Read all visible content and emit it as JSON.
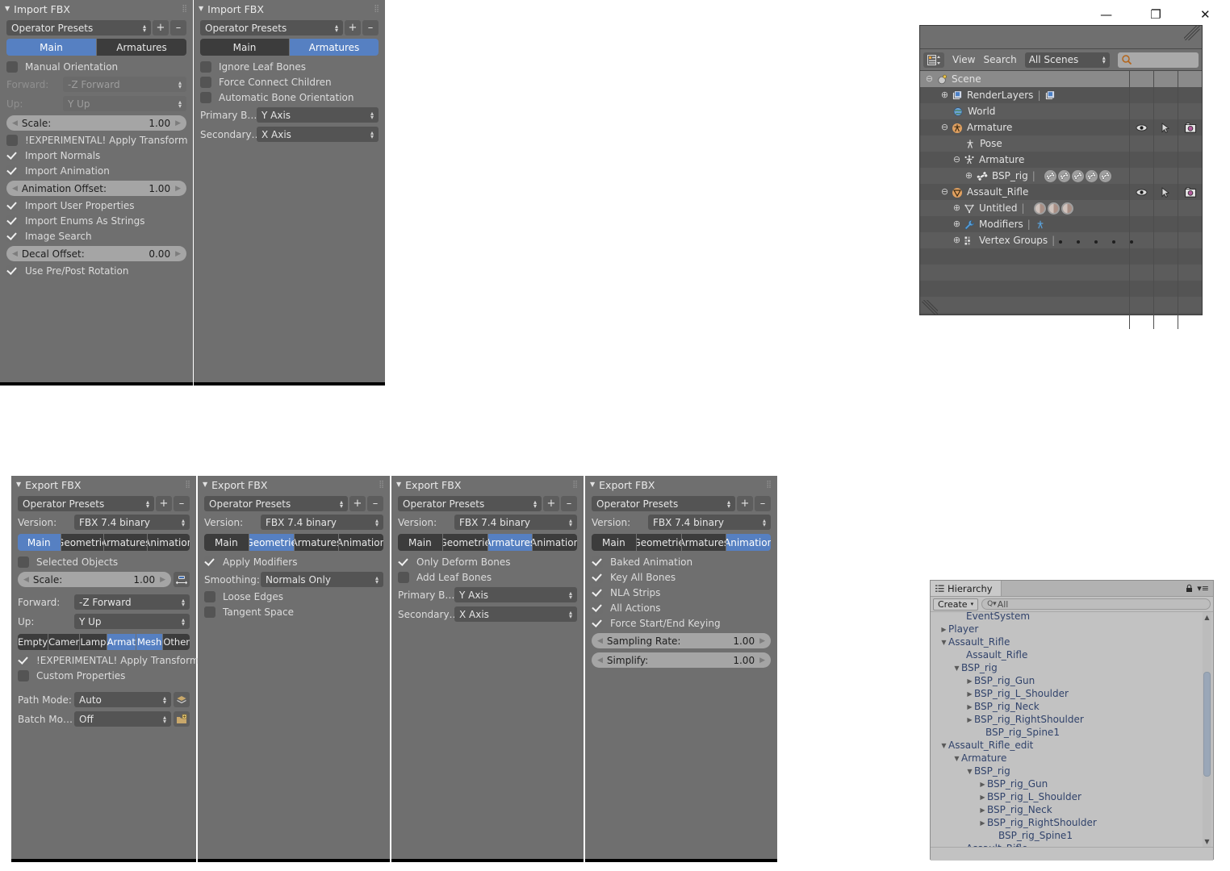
{
  "window": {
    "minimize": "—",
    "maximize": "❐",
    "close": "✕"
  },
  "import_main": {
    "title": "Import FBX",
    "preset": "Operator Presets",
    "add_btn": "+",
    "remove_btn": "–",
    "tabs": [
      {
        "label": "Main",
        "active": true
      },
      {
        "label": "Armatures",
        "active": false
      }
    ],
    "manual_orientation": {
      "label": "Manual Orientation",
      "checked": false
    },
    "forward": {
      "label": "Forward:",
      "value": "-Z Forward",
      "enabled": false
    },
    "up": {
      "label": "Up:",
      "value": "Y Up",
      "enabled": false
    },
    "scale": {
      "label": "Scale:",
      "value": "1.00"
    },
    "apply_transform": {
      "label": "!EXPERIMENTAL! Apply Transform",
      "checked": false
    },
    "import_normals": {
      "label": "Import Normals",
      "checked": true
    },
    "import_animation": {
      "label": "Import Animation",
      "checked": true
    },
    "animation_offset": {
      "label": "Animation Offset:",
      "value": "1.00"
    },
    "import_user_properties": {
      "label": "Import User Properties",
      "checked": true
    },
    "import_enums": {
      "label": "Import Enums As Strings",
      "checked": true
    },
    "image_search": {
      "label": "Image Search",
      "checked": true
    },
    "decal_offset": {
      "label": "Decal Offset:",
      "value": "0.00"
    },
    "use_prepost_rotation": {
      "label": "Use Pre/Post Rotation",
      "checked": true
    }
  },
  "import_armatures": {
    "title": "Import FBX",
    "preset": "Operator Presets",
    "add_btn": "+",
    "remove_btn": "–",
    "tabs": [
      {
        "label": "Main",
        "active": false
      },
      {
        "label": "Armatures",
        "active": true
      }
    ],
    "ignore_leaf_bones": {
      "label": "Ignore Leaf Bones",
      "checked": false
    },
    "force_connect_children": {
      "label": "Force Connect Children",
      "checked": false
    },
    "automatic_bone_orientation": {
      "label": "Automatic Bone Orientation",
      "checked": false
    },
    "primary_bone_axis": {
      "label": "Primary B…",
      "value": "Y Axis"
    },
    "secondary_bone_axis": {
      "label": "Secondary…",
      "value": "X Axis"
    }
  },
  "export_main": {
    "title": "Export FBX",
    "preset": "Operator Presets",
    "add_btn": "+",
    "remove_btn": "–",
    "version": {
      "label": "Version:",
      "value": "FBX 7.4 binary"
    },
    "tabs": [
      {
        "label": "Main",
        "active": true
      },
      {
        "label": "Geometrie",
        "active": false
      },
      {
        "label": "Armatures",
        "active": false
      },
      {
        "label": "Animation",
        "active": false
      }
    ],
    "selected_objects": {
      "label": "Selected Objects",
      "checked": false
    },
    "scale": {
      "label": "Scale:",
      "value": "1.00"
    },
    "forward": {
      "label": "Forward:",
      "value": "-Z Forward"
    },
    "up": {
      "label": "Up:",
      "value": "Y Up"
    },
    "object_types": [
      {
        "label": "Empty",
        "active": false
      },
      {
        "label": "Camer",
        "active": false
      },
      {
        "label": "Lamp",
        "active": false
      },
      {
        "label": "Armat",
        "active": true
      },
      {
        "label": "Mesh",
        "active": true
      },
      {
        "label": "Other",
        "active": false
      }
    ],
    "apply_transform": {
      "label": "!EXPERIMENTAL! Apply Transform",
      "checked": true
    },
    "custom_properties": {
      "label": "Custom Properties",
      "checked": false
    },
    "path_mode": {
      "label": "Path Mode:",
      "value": "Auto"
    },
    "batch_mode": {
      "label": "Batch Mo…",
      "value": "Off"
    }
  },
  "export_geometries": {
    "title": "Export FBX",
    "preset": "Operator Presets",
    "add_btn": "+",
    "remove_btn": "–",
    "version": {
      "label": "Version:",
      "value": "FBX 7.4 binary"
    },
    "tabs": [
      {
        "label": "Main",
        "active": false
      },
      {
        "label": "Geometrie",
        "active": true
      },
      {
        "label": "Armatures",
        "active": false
      },
      {
        "label": "Animation",
        "active": false
      }
    ],
    "apply_modifiers": {
      "label": "Apply Modifiers",
      "checked": true
    },
    "smoothing": {
      "label": "Smoothing:",
      "value": "Normals Only"
    },
    "loose_edges": {
      "label": "Loose Edges",
      "checked": false
    },
    "tangent_space": {
      "label": "Tangent Space",
      "checked": false
    }
  },
  "export_armatures": {
    "title": "Export FBX",
    "preset": "Operator Presets",
    "add_btn": "+",
    "remove_btn": "–",
    "version": {
      "label": "Version:",
      "value": "FBX 7.4 binary"
    },
    "tabs": [
      {
        "label": "Main",
        "active": false
      },
      {
        "label": "Geometrie",
        "active": false
      },
      {
        "label": "Armatures",
        "active": true
      },
      {
        "label": "Animation",
        "active": false
      }
    ],
    "only_deform_bones": {
      "label": "Only Deform Bones",
      "checked": true
    },
    "add_leaf_bones": {
      "label": "Add Leaf Bones",
      "checked": false
    },
    "primary_bone_axis": {
      "label": "Primary B…",
      "value": "Y Axis"
    },
    "secondary_bone_axis": {
      "label": "Secondary…",
      "value": "X Axis"
    }
  },
  "export_animation": {
    "title": "Export FBX",
    "preset": "Operator Presets",
    "add_btn": "+",
    "remove_btn": "–",
    "version": {
      "label": "Version:",
      "value": "FBX 7.4 binary"
    },
    "tabs": [
      {
        "label": "Main",
        "active": false
      },
      {
        "label": "Geometrie",
        "active": false
      },
      {
        "label": "Armatures",
        "active": false
      },
      {
        "label": "Animation",
        "active": true
      }
    ],
    "baked_animation": {
      "label": "Baked Animation",
      "checked": true
    },
    "key_all_bones": {
      "label": "Key All Bones",
      "checked": true
    },
    "nla_strips": {
      "label": "NLA Strips",
      "checked": true
    },
    "all_actions": {
      "label": "All Actions",
      "checked": true
    },
    "force_start_end_keying": {
      "label": "Force Start/End Keying",
      "checked": true
    },
    "sampling_rate": {
      "label": "Sampling Rate:",
      "value": "1.00"
    },
    "simplify": {
      "label": "Simplify:",
      "value": "1.00"
    }
  },
  "outliner": {
    "menu_view": "View",
    "menu_search": "Search",
    "scene_filter": "All Scenes",
    "search_value": "",
    "rows": [
      {
        "name": "Scene",
        "indent": 0,
        "toggle": "minus",
        "icon": "scene-icon",
        "selected": true
      },
      {
        "name": "RenderLayers",
        "indent": 1,
        "toggle": "plus",
        "icon": "renderlayers-icon",
        "extra": "renderlayer-chip"
      },
      {
        "name": "World",
        "indent": 1,
        "toggle": "none",
        "icon": "world-icon"
      },
      {
        "name": "Armature",
        "indent": 1,
        "toggle": "minus",
        "icon": "armature-object-icon",
        "cols": true
      },
      {
        "name": "Pose",
        "indent": 2,
        "toggle": "none",
        "icon": "pose-icon"
      },
      {
        "name": "Armature",
        "indent": 2,
        "toggle": "minus",
        "icon": "armature-data-icon"
      },
      {
        "name": "BSP_rig",
        "indent": 3,
        "toggle": "plus",
        "icon": "bone-icon",
        "chips": 5,
        "chip_kind": "bone"
      },
      {
        "name": "Assault_Rifle",
        "indent": 1,
        "toggle": "minus",
        "icon": "mesh-object-icon",
        "cols": true
      },
      {
        "name": "Untitled",
        "indent": 2,
        "toggle": "plus",
        "icon": "mesh-data-icon",
        "chips": 3,
        "chip_kind": "material"
      },
      {
        "name": "Modifiers",
        "indent": 2,
        "toggle": "plus",
        "icon": "wrench-icon",
        "chips": 1,
        "chip_kind": "armature-mod"
      },
      {
        "name": "Vertex Groups",
        "indent": 2,
        "toggle": "plus",
        "icon": "vertexgroup-icon",
        "dots": 5
      }
    ]
  },
  "unity": {
    "tab_label": "Hierarchy",
    "create_label": "Create",
    "create_caret": "▾",
    "search_placeholder": "All",
    "search_icon": "Q",
    "lock_icon": "🔒",
    "menu_icon": "≡",
    "rows": [
      {
        "name": "EventSystem",
        "indent": 1,
        "arrow": "none",
        "style": "prefab",
        "clipped": true
      },
      {
        "name": "Player",
        "indent": 1,
        "arrow": "right",
        "style": "prefab"
      },
      {
        "name": "Assault_Rifle",
        "indent": 1,
        "arrow": "down",
        "style": "prefab"
      },
      {
        "name": "Assault_Rifle",
        "indent": 2,
        "arrow": "none",
        "style": "prefab"
      },
      {
        "name": "BSP_rig",
        "indent": 2,
        "arrow": "down",
        "style": "prefab"
      },
      {
        "name": "BSP_rig_Gun",
        "indent": 3,
        "arrow": "right",
        "style": "prefab"
      },
      {
        "name": "BSP_rig_L_Shoulder",
        "indent": 3,
        "arrow": "right",
        "style": "prefab"
      },
      {
        "name": "BSP_rig_Neck",
        "indent": 3,
        "arrow": "right",
        "style": "prefab"
      },
      {
        "name": "BSP_rig_RightShoulder",
        "indent": 3,
        "arrow": "right",
        "style": "prefab"
      },
      {
        "name": "BSP_rig_Spine1",
        "indent": 3,
        "arrow": "none",
        "style": "prefab"
      },
      {
        "name": "Assault_Rifle_edit",
        "indent": 1,
        "arrow": "down",
        "style": "prefab"
      },
      {
        "name": "Armature",
        "indent": 2,
        "arrow": "down",
        "style": "prefab"
      },
      {
        "name": "BSP_rig",
        "indent": 3,
        "arrow": "down",
        "style": "prefab"
      },
      {
        "name": "BSP_rig_Gun",
        "indent": 4,
        "arrow": "right",
        "style": "prefab"
      },
      {
        "name": "BSP_rig_L_Shoulder",
        "indent": 4,
        "arrow": "right",
        "style": "prefab"
      },
      {
        "name": "BSP_rig_Neck",
        "indent": 4,
        "arrow": "right",
        "style": "prefab"
      },
      {
        "name": "BSP_rig_RightShoulder",
        "indent": 4,
        "arrow": "right",
        "style": "prefab"
      },
      {
        "name": "BSP_rig_Spine1",
        "indent": 4,
        "arrow": "none",
        "style": "prefab"
      },
      {
        "name": "Assault_Rifle",
        "indent": 1,
        "arrow": "none",
        "style": "prefab"
      }
    ]
  },
  "colors": {
    "accent_blue": "#5680c2",
    "panel_bg": "#6f6f6f",
    "field_bg": "#545454",
    "slider_bg": "#a5a5a5",
    "unity_bg": "#c2c2c2",
    "unity_text": "#31436b"
  }
}
